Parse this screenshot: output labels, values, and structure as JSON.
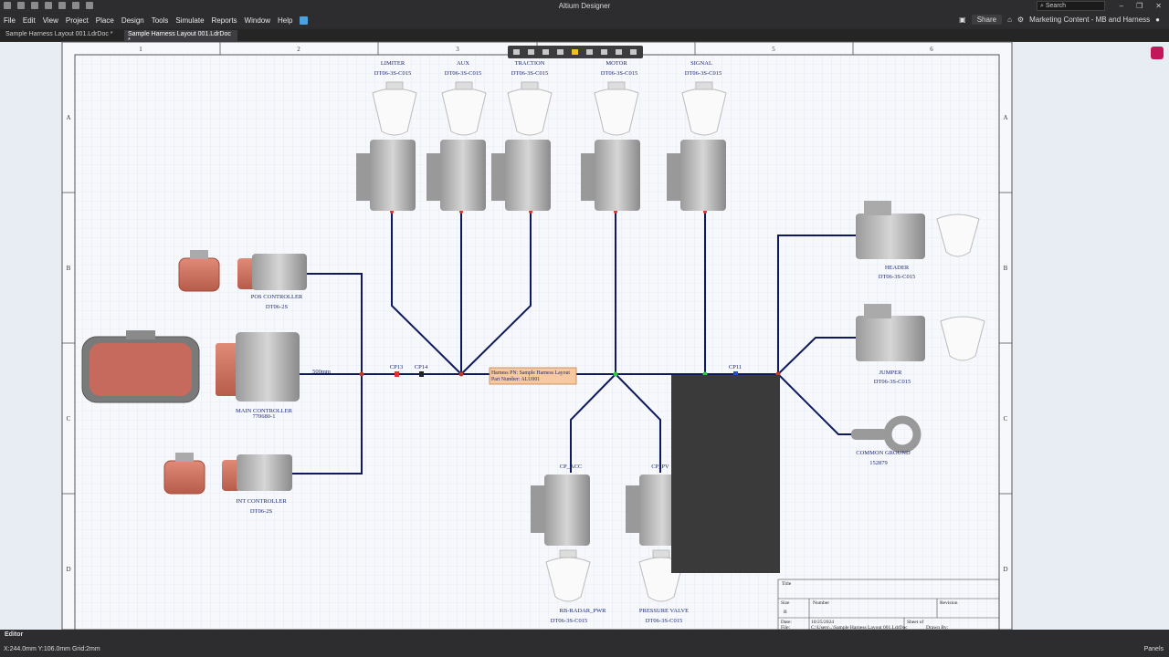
{
  "app": {
    "title": "Altium Designer",
    "search_placeholder": "Search",
    "share_label": "Share",
    "workspace_label": "Marketing Content - MB and Harness"
  },
  "menu": [
    "File",
    "Edit",
    "View",
    "Project",
    "Place",
    "Design",
    "Tools",
    "Simulate",
    "Reports",
    "Window",
    "Help"
  ],
  "tabs": [
    {
      "label": "Sample Harness Layout 001.LdrDoc *",
      "active": false
    },
    {
      "label": "Sample Harness Layout 001.LdrDoc *",
      "active": true
    }
  ],
  "ruler": {
    "columns": [
      "1",
      "2",
      "3",
      "4",
      "5",
      "6"
    ],
    "rows": [
      "A",
      "B",
      "C",
      "D"
    ]
  },
  "connectors_top": [
    {
      "name": "LIMITER",
      "pn": "DT06-3S-C015"
    },
    {
      "name": "AUX",
      "pn": "DT06-3S-C015"
    },
    {
      "name": "TRACTION",
      "pn": "DT06-3S-C015"
    },
    {
      "name": "MOTOR",
      "pn": "DT06-3S-C015"
    },
    {
      "name": "SIGNAL",
      "pn": "DT06-3S-C015"
    }
  ],
  "connectors_left": [
    {
      "name": "POS CONTROLLER",
      "pn": "DT06-2S"
    },
    {
      "name": "MAIN CONTROLLER",
      "pn": "770680-1"
    },
    {
      "name": "INT CONTROLLER",
      "pn": "DT06-2S"
    }
  ],
  "connectors_right": [
    {
      "name": "HEADER",
      "pn": "DT06-3S-C015"
    },
    {
      "name": "JUMPER",
      "pn": "DT06-3S-C015"
    },
    {
      "name": "COMMON GROUND",
      "pn": "152879"
    }
  ],
  "connectors_bottom": [
    {
      "name": "RB-RADAR_PWR",
      "pn": "DT06-3S-C015",
      "cp": "CP_ACC"
    },
    {
      "name": "PRESSURE VALVE",
      "pn": "DT06-3S-C015",
      "cp": "CP_PV"
    }
  ],
  "points": {
    "cp13": "CP13",
    "cp14": "CP14",
    "cp11": "CP11",
    "length": "500mm"
  },
  "harness_label": {
    "line1": "Harness PN: Sample Harness Layout",
    "line2": "Part Number: ALU001"
  },
  "title_block": {
    "title": "Title",
    "size": "Size",
    "size_val": "B",
    "number": "Number",
    "revision": "Revision",
    "date": "Date:",
    "date_val": "10/25/2024",
    "sheet": "Sheet   of",
    "file": "File:",
    "file_val": "C:\\Users\\..\\Sample Harness Layout 001.LdrDoc",
    "drawn": "Drawn By:"
  },
  "status": {
    "editor": "Editor",
    "coords": "X:244.0mm Y:106.0mm",
    "grid": "Grid:2mm",
    "panels": "Panels"
  },
  "colors": {
    "wire": "#0f1a5e",
    "ui_dark": "#2d2d30",
    "sheet_bg": "#f6f8fc",
    "accent": "#c2185b"
  }
}
